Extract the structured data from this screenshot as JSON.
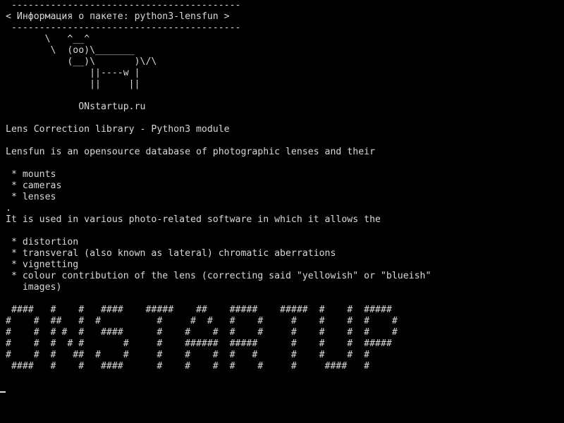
{
  "terminal": {
    "lines": [
      " -----------------------------------------",
      "< Информация о пакете: python3-lensfun >",
      " -----------------------------------------",
      "       \\   ^__^",
      "        \\  (oo)\\_______",
      "           (__)\\       )\\/\\",
      "               ||----w |",
      "               ||     ||",
      "",
      "             ONstartup.ru",
      "",
      "Lens Correction library - Python3 module",
      "",
      "Lensfun is an opensource database of photographic lenses and their",
      "",
      " * mounts",
      " * cameras",
      " * lenses",
      ".",
      "It is used in various photo-related software in which it allows the",
      "",
      " * distortion",
      " * transveral (also known as lateral) chromatic aberrations",
      " * vignetting",
      " * colour contribution of the lens (correcting said \"yellowish\" or \"blueish\"",
      "   images)",
      "",
      " ####   #    #   ####    #####    ##    #####    #####  #    #  #####",
      "#    #  ##   #  #          #     #  #   #    #     #    #    #  #    #",
      "#    #  # #  #   ####      #    #    #  #    #     #    #    #  #    #",
      "#    #  #  # #       #     #    ######  #####      #    #    #  #####",
      "#    #  #   ##  #    #     #    #    #  #   #      #    #    #  #",
      " ####   #    #   ####      #    #    #  #    #     #     ####   #"
    ]
  }
}
